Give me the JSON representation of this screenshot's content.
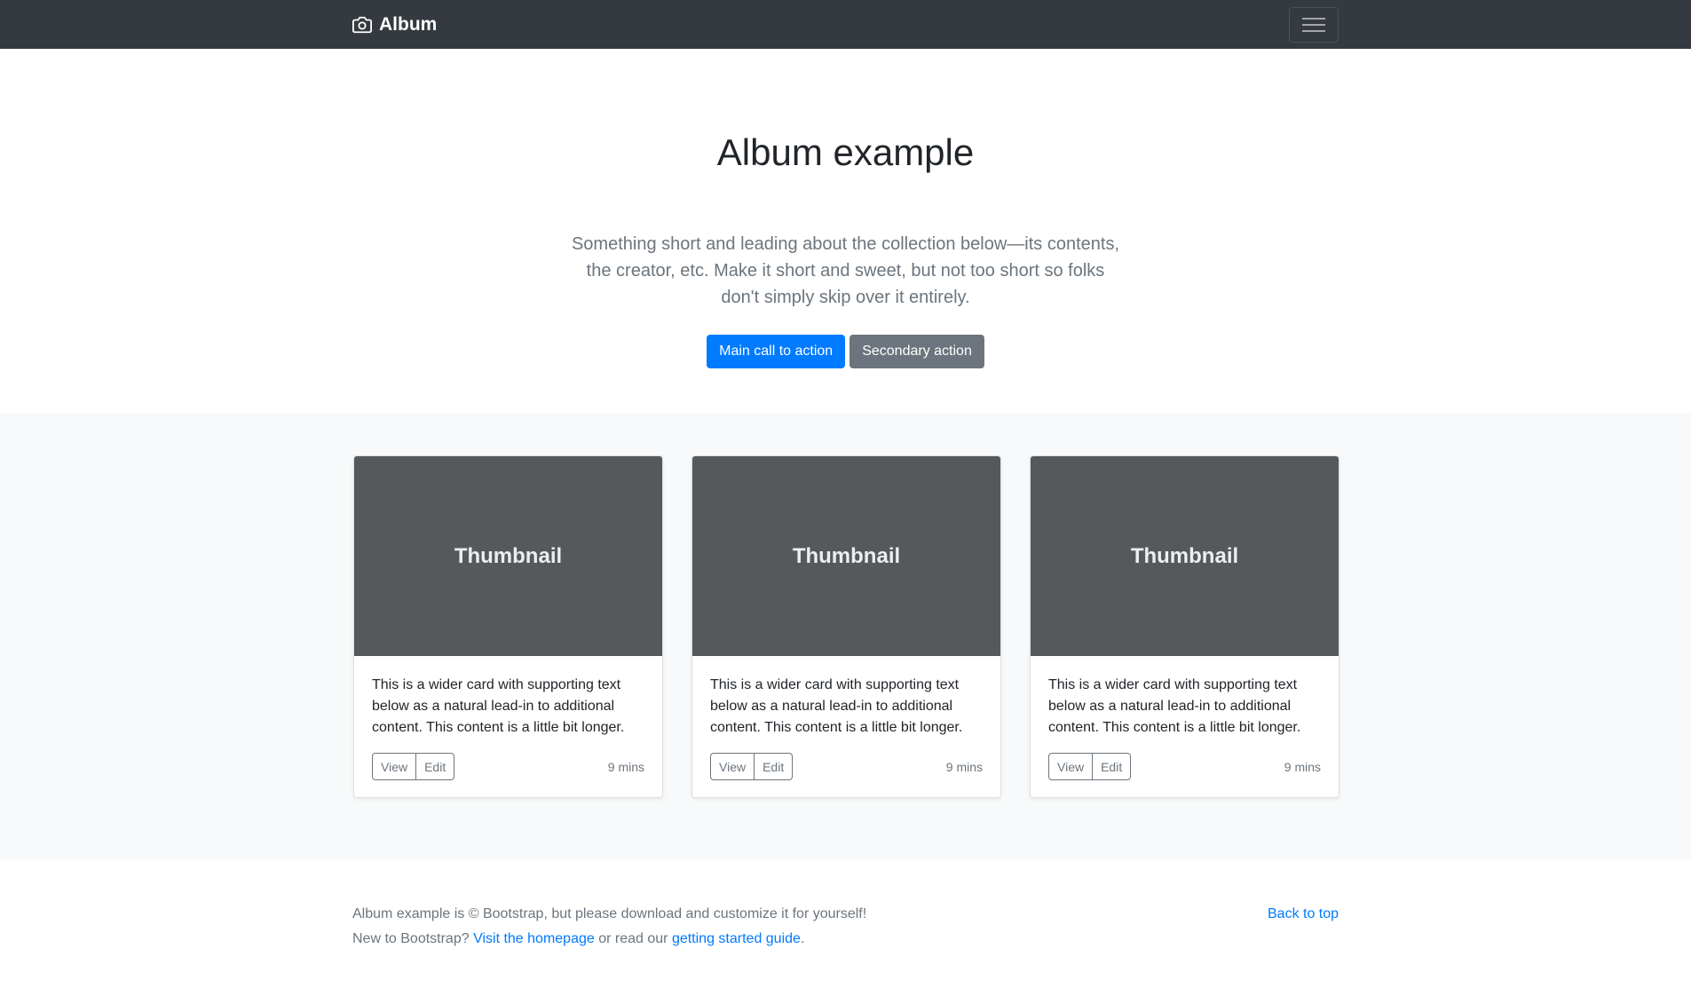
{
  "navbar": {
    "brand": "Album",
    "brand_icon": "camera-icon",
    "toggler_icon": "hamburger-menu-icon",
    "background": "#343a40"
  },
  "hero": {
    "heading": "Album example",
    "lead": "Something short and leading about the collection below—its contents, the creator, etc. Make it short and sweet, but not too short so folks don't simply skip over it entirely.",
    "primary_button": "Main call to action",
    "secondary_button": "Secondary action"
  },
  "cards": [
    {
      "thumbnail_label": "Thumbnail",
      "text": "This is a wider card with supporting text below as a natural lead-in to additional content. This content is a little bit longer.",
      "view_label": "View",
      "edit_label": "Edit",
      "time": "9 mins"
    },
    {
      "thumbnail_label": "Thumbnail",
      "text": "This is a wider card with supporting text below as a natural lead-in to additional content. This content is a little bit longer.",
      "view_label": "View",
      "edit_label": "Edit",
      "time": "9 mins"
    },
    {
      "thumbnail_label": "Thumbnail",
      "text": "This is a wider card with supporting text below as a natural lead-in to additional content. This content is a little bit longer.",
      "view_label": "View",
      "edit_label": "Edit",
      "time": "9 mins"
    }
  ],
  "footer": {
    "line1": "Album example is © Bootstrap, but please download and customize it for yourself!",
    "line2_prefix": "New to Bootstrap?",
    "homepage_link": "Visit the homepage",
    "line2_middle": "or read our",
    "guide_link": "getting started guide",
    "line2_suffix": ".",
    "back_to_top": "Back to top"
  },
  "colors": {
    "primary": "#007bff",
    "secondary": "#6c757d",
    "thumbnail_bg": "#55595c",
    "album_bg": "#f8f9fa"
  }
}
